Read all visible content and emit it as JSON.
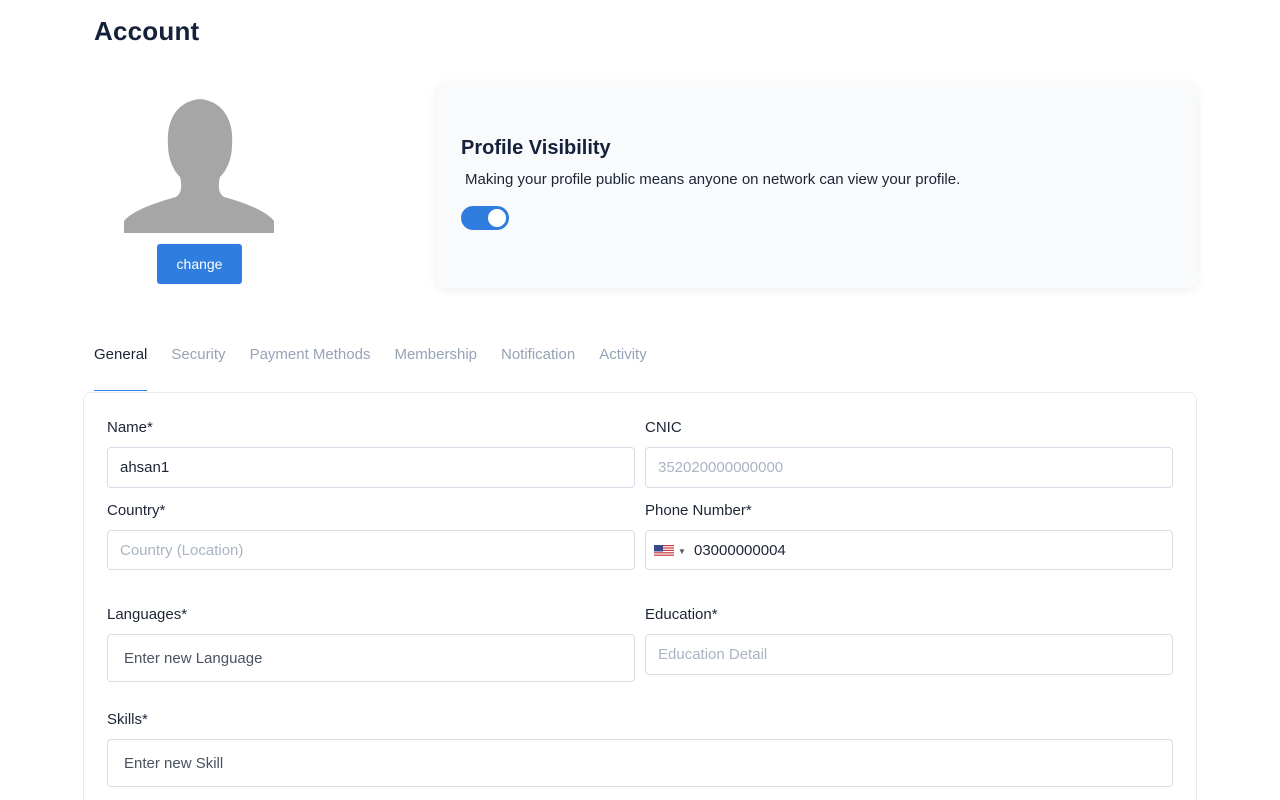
{
  "page": {
    "title": "Account"
  },
  "avatar": {
    "change_label": "change"
  },
  "visibility": {
    "title": "Profile Visibility",
    "description": "Making your profile public means anyone on network can view your profile.",
    "enabled": true
  },
  "tabs": [
    {
      "label": "General",
      "active": true
    },
    {
      "label": "Security",
      "active": false
    },
    {
      "label": "Payment Methods",
      "active": false
    },
    {
      "label": "Membership",
      "active": false
    },
    {
      "label": "Notification",
      "active": false
    },
    {
      "label": "Activity",
      "active": false
    }
  ],
  "form": {
    "name": {
      "label": "Name*",
      "value": "ahsan1"
    },
    "cnic": {
      "label": "CNIC",
      "placeholder": "352020000000000"
    },
    "country": {
      "label": "Country*",
      "placeholder": "Country (Location)"
    },
    "phone": {
      "label": "Phone Number*",
      "value": "03000000004",
      "country_flag": "us-flag-icon"
    },
    "languages": {
      "label": "Languages*",
      "placeholder": "Enter new Language"
    },
    "education": {
      "label": "Education*",
      "placeholder": "Education Detail"
    },
    "skills": {
      "label": "Skills*",
      "placeholder": "Enter new Skill"
    }
  },
  "colors": {
    "accent": "#2e7ddf",
    "title": "#15213a",
    "muted": "#97a3b6"
  }
}
